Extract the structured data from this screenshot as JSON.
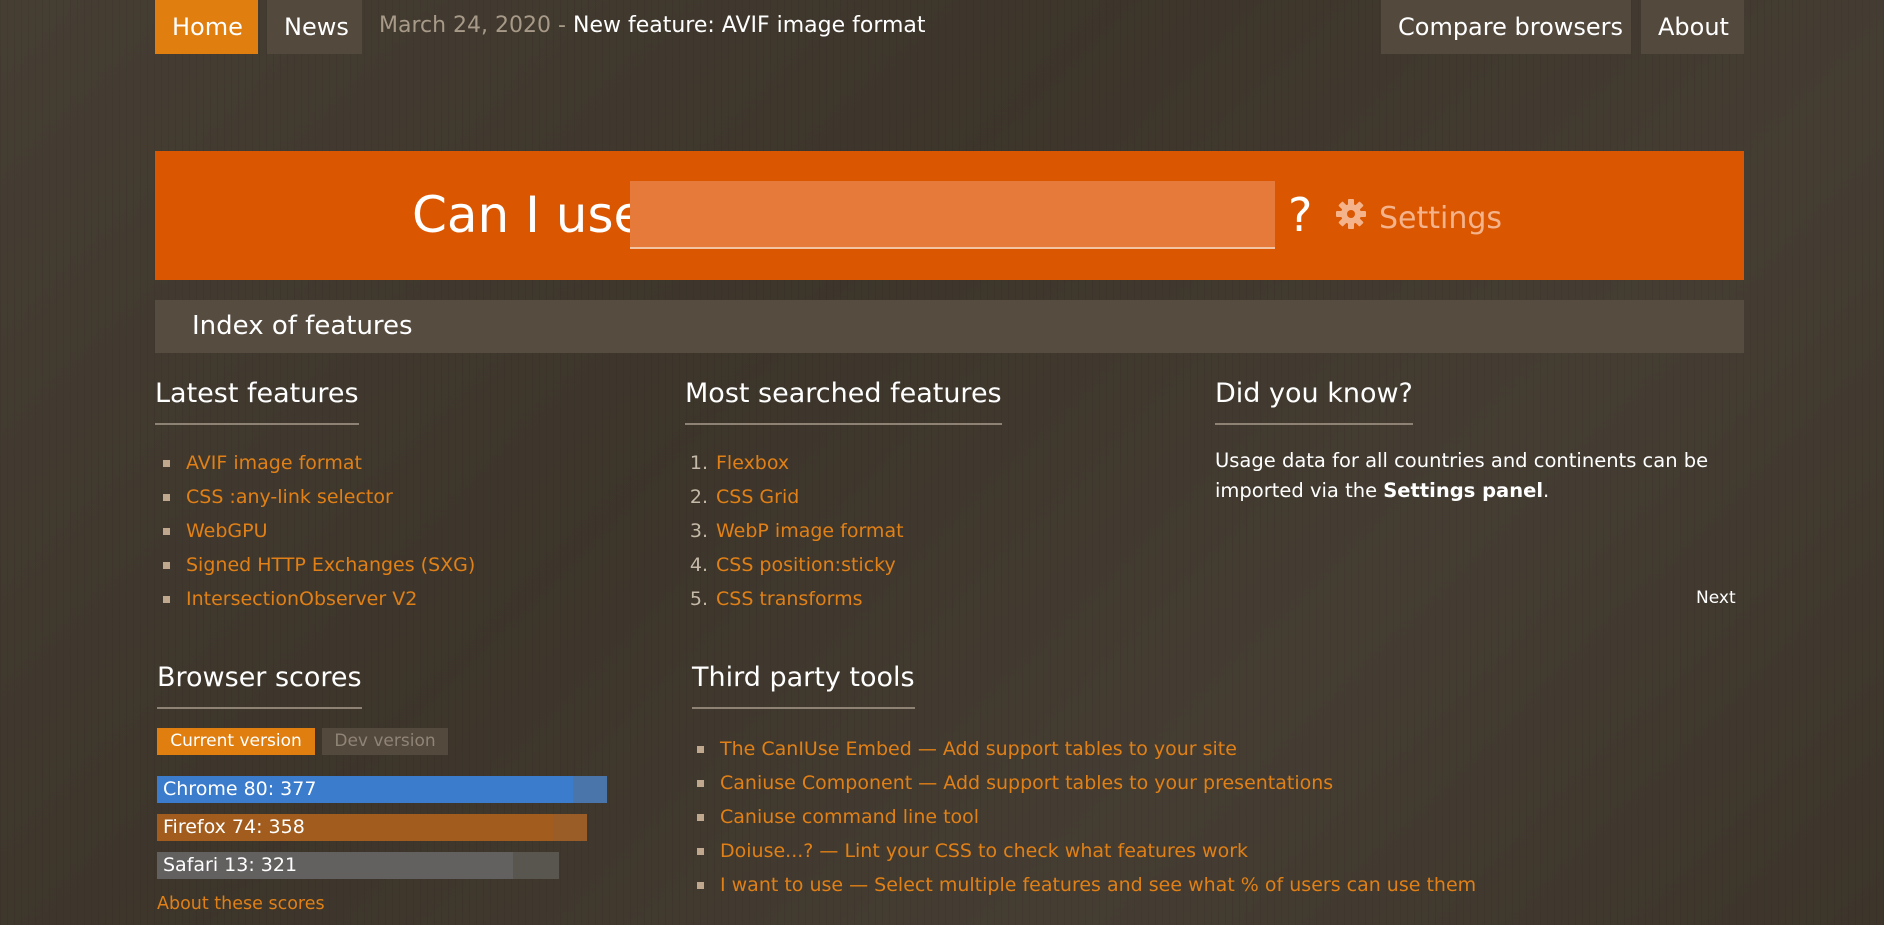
{
  "header": {
    "home": "Home",
    "news": "News",
    "news_date": "March 24, 2020",
    "news_separator": "-",
    "news_title": "New feature: AVIF image format",
    "compare": "Compare browsers",
    "about": "About"
  },
  "search": {
    "label": "Can I use",
    "placeholder": "",
    "value": "",
    "question_mark": "?",
    "settings": "Settings",
    "settings_icon": "gear-icon"
  },
  "index_title": "Index of features",
  "latest": {
    "title": "Latest features",
    "items": [
      "AVIF image format",
      "CSS :any-link selector",
      "WebGPU",
      "Signed HTTP Exchanges (SXG)",
      "IntersectionObserver V2"
    ]
  },
  "most_searched": {
    "title": "Most searched features",
    "items": [
      {
        "num": "1.",
        "label": "Flexbox"
      },
      {
        "num": "2.",
        "label": "CSS Grid"
      },
      {
        "num": "3.",
        "label": "WebP image format"
      },
      {
        "num": "4.",
        "label": "CSS position:sticky"
      },
      {
        "num": "5.",
        "label": "CSS transforms"
      }
    ]
  },
  "did_you_know": {
    "title": "Did you know?",
    "text_before": "Usage data for all countries and continents can be imported via the ",
    "text_bold": "Settings panel",
    "text_after": ".",
    "next": "Next"
  },
  "browser_scores": {
    "title": "Browser scores",
    "tab_current": "Current version",
    "tab_dev": "Dev version",
    "scores": [
      {
        "label": "Chrome 80: 377",
        "fraction": 0.925,
        "color": "#3b7ccc",
        "track": "#4a75aa"
      },
      {
        "label": "Firefox 74: 358",
        "fraction": 0.88,
        "color": "#a25d1e",
        "track": "#9a5d27"
      },
      {
        "label": "Safari 13: 321",
        "fraction": 0.79,
        "color": "#636060",
        "track": "#59554f"
      }
    ],
    "about": "About these scores"
  },
  "third_party": {
    "title": "Third party tools",
    "items": [
      "The CanIUse Embed — Add support tables to your site",
      "Caniuse Component — Add support tables to your presentations",
      "Caniuse command line tool",
      "Doiuse...? — Lint your CSS to check what features work",
      "I want to use — Select multiple features and see what % of users can use them"
    ]
  },
  "colors": {
    "accent_orange": "#e07f10",
    "banner_orange": "#db5600",
    "link_orange": "#e08016",
    "background": "#3f372c"
  }
}
